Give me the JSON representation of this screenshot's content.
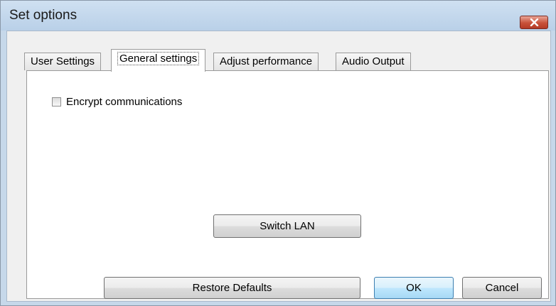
{
  "window": {
    "title": "Set options"
  },
  "tabs": [
    {
      "label": "User Settings",
      "active": false
    },
    {
      "label": "General settings",
      "active": true
    },
    {
      "label": "Adjust performance",
      "active": false
    },
    {
      "label": "Audio Output",
      "active": false
    }
  ],
  "general": {
    "encrypt_label": "Encrypt communications",
    "encrypt_checked": false,
    "switch_lan_label": "Switch LAN"
  },
  "footer": {
    "restore_label": "Restore Defaults",
    "ok_label": "OK",
    "cancel_label": "Cancel"
  },
  "colors": {
    "close_button": "#c8513a",
    "default_button_border": "#3c7fb1"
  },
  "icons": {
    "close": "close-icon"
  }
}
